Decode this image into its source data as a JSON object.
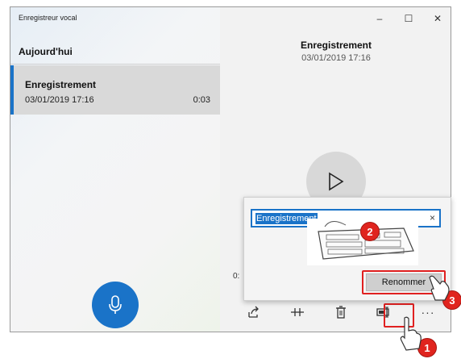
{
  "window": {
    "title": "Enregistreur vocal"
  },
  "controls": {
    "minimize": "–",
    "maximize": "☐",
    "close": "✕"
  },
  "sidebar": {
    "group_header": "Aujourd'hui",
    "items": [
      {
        "name": "Enregistrement",
        "date": "03/01/2019 17:16",
        "duration": "0:03"
      }
    ]
  },
  "detail": {
    "title": "Enregistrement",
    "date": "03/01/2019 17:16",
    "time_partial": "0:"
  },
  "rename_flyout": {
    "input_value": "Enregistrement",
    "clear_label": "×",
    "button_label": "Renommer"
  },
  "toolbar": {
    "more_label": "···"
  },
  "annotations": {
    "step1": "1",
    "step2": "2",
    "step3": "3"
  },
  "colors": {
    "accent": "#1a73c8",
    "annotation_red": "#e0241e"
  }
}
